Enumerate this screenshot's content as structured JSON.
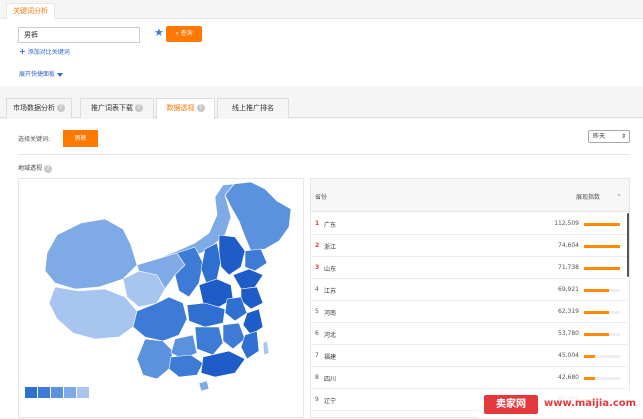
{
  "header": {
    "tab_label": "关键词分析"
  },
  "search": {
    "keyword_value": "男裤",
    "query_label": "查询",
    "add_compare_label": "添加对比关键词",
    "expand_panel_label": "展开快捷面板"
  },
  "tabs": [
    {
      "label": "市场数据分析"
    },
    {
      "label": "推广词表下载"
    },
    {
      "label": "数据透视"
    },
    {
      "label": "线上推广排名"
    }
  ],
  "content": {
    "keyword_label": "选择关键词:",
    "keyword_chip": "男裤",
    "period_value": "昨天",
    "map_title": "地域透视"
  },
  "table": {
    "col_province": "省份",
    "col_index": "展现指数",
    "rows": [
      {
        "rank": "1",
        "province": "广东",
        "value": "112,509",
        "ratio": 1.0
      },
      {
        "rank": "2",
        "province": "浙江",
        "value": "74,604",
        "ratio": 1.0
      },
      {
        "rank": "3",
        "province": "山东",
        "value": "71,738",
        "ratio": 1.0
      },
      {
        "rank": "4",
        "province": "江苏",
        "value": "69,921",
        "ratio": 0.7
      },
      {
        "rank": "5",
        "province": "河南",
        "value": "62,319",
        "ratio": 0.7
      },
      {
        "rank": "6",
        "province": "河北",
        "value": "53,780",
        "ratio": 0.7
      },
      {
        "rank": "7",
        "province": "福建",
        "value": "45,004",
        "ratio": 0.3
      },
      {
        "rank": "8",
        "province": "四川",
        "value": "42,680",
        "ratio": 0.3
      },
      {
        "rank": "9",
        "province": "辽宁",
        "value": "40,267",
        "ratio": 0.3
      }
    ]
  },
  "legend_colors": [
    "#2f6fd0",
    "#3d7bd6",
    "#5b92de",
    "#7eaae6",
    "#a7c5ef"
  ],
  "accent_color": "#ff7800",
  "watermark": {
    "logo": "卖家网",
    "url": "www.maijia.com"
  }
}
